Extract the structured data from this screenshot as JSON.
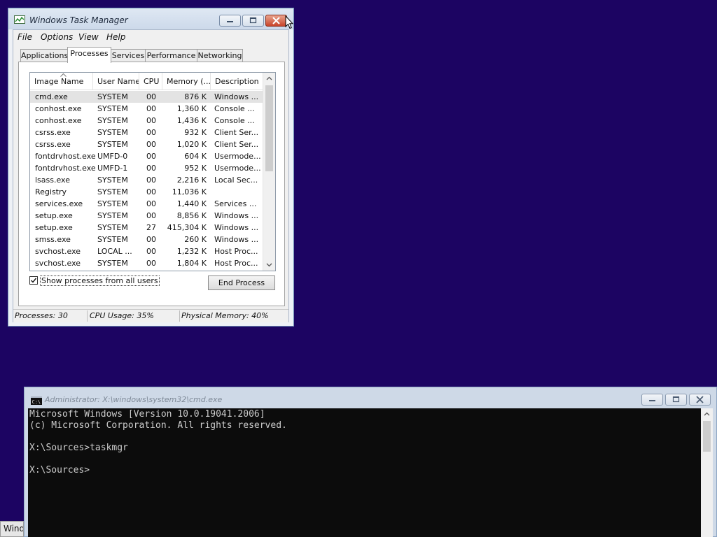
{
  "task_manager": {
    "title": "Windows Task Manager",
    "menu": [
      "File",
      "Options",
      "View",
      "Help"
    ],
    "tabs": [
      "Applications",
      "Processes",
      "Services",
      "Performance",
      "Networking"
    ],
    "active_tab": "Processes",
    "columns": [
      "Image Name",
      "User Name",
      "CPU",
      "Memory (...",
      "Description"
    ],
    "rows": [
      {
        "name": "cmd.exe",
        "user": "SYSTEM",
        "cpu": "00",
        "mem": "876 K",
        "desc": "Windows ..."
      },
      {
        "name": "conhost.exe",
        "user": "SYSTEM",
        "cpu": "00",
        "mem": "1,360 K",
        "desc": "Console ..."
      },
      {
        "name": "conhost.exe",
        "user": "SYSTEM",
        "cpu": "00",
        "mem": "1,436 K",
        "desc": "Console ..."
      },
      {
        "name": "csrss.exe",
        "user": "SYSTEM",
        "cpu": "00",
        "mem": "932 K",
        "desc": "Client Ser..."
      },
      {
        "name": "csrss.exe",
        "user": "SYSTEM",
        "cpu": "00",
        "mem": "1,020 K",
        "desc": "Client Ser..."
      },
      {
        "name": "fontdrvhost.exe",
        "user": "UMFD-0",
        "cpu": "00",
        "mem": "604 K",
        "desc": "Usermode..."
      },
      {
        "name": "fontdrvhost.exe",
        "user": "UMFD-1",
        "cpu": "00",
        "mem": "952 K",
        "desc": "Usermode..."
      },
      {
        "name": "lsass.exe",
        "user": "SYSTEM",
        "cpu": "00",
        "mem": "2,216 K",
        "desc": "Local Sec..."
      },
      {
        "name": "Registry",
        "user": "SYSTEM",
        "cpu": "00",
        "mem": "11,036 K",
        "desc": ""
      },
      {
        "name": "services.exe",
        "user": "SYSTEM",
        "cpu": "00",
        "mem": "1,440 K",
        "desc": "Services ..."
      },
      {
        "name": "setup.exe",
        "user": "SYSTEM",
        "cpu": "00",
        "mem": "8,856 K",
        "desc": "Windows ..."
      },
      {
        "name": "setup.exe",
        "user": "SYSTEM",
        "cpu": "27",
        "mem": "415,304 K",
        "desc": "Windows ..."
      },
      {
        "name": "smss.exe",
        "user": "SYSTEM",
        "cpu": "00",
        "mem": "260 K",
        "desc": "Windows ..."
      },
      {
        "name": "svchost.exe",
        "user": "LOCAL ...",
        "cpu": "00",
        "mem": "1,232 K",
        "desc": "Host Proc..."
      },
      {
        "name": "svchost.exe",
        "user": "SYSTEM",
        "cpu": "00",
        "mem": "1,804 K",
        "desc": "Host Proc..."
      }
    ],
    "selected_row": "cmd.exe",
    "show_all_label": "Show processes from all users",
    "show_all_checked": true,
    "end_process_label": "End Process",
    "status": {
      "processes": "Processes: 30",
      "cpu": "CPU Usage: 35%",
      "memory": "Physical Memory: 40%"
    }
  },
  "cmd": {
    "title": "Administrator: X:\\windows\\system32\\cmd.exe",
    "lines": [
      "Microsoft Windows [Version 10.0.19041.2006]",
      "(c) Microsoft Corporation. All rights reserved.",
      "",
      "X:\\Sources>taskmgr",
      "",
      "X:\\Sources>"
    ]
  },
  "taskbar": {
    "item_label": "Wind"
  },
  "colors": {
    "desktop": "#1c0462",
    "close_button": "#c8452a",
    "console_bg": "#0c0c0c",
    "console_text": "#cccccc"
  }
}
